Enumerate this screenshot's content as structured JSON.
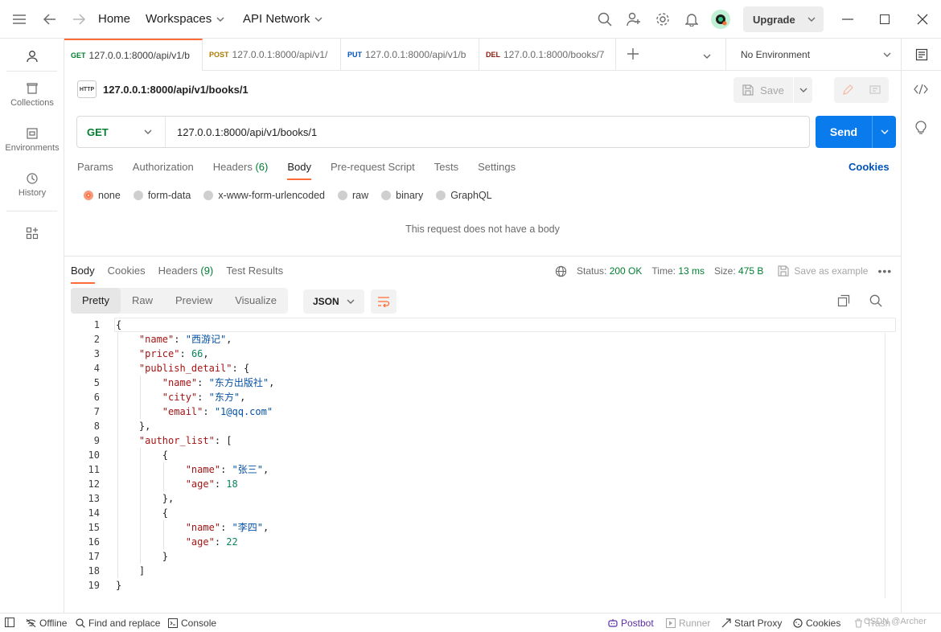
{
  "topbar": {
    "home": "Home",
    "workspaces": "Workspaces",
    "api_network": "API Network",
    "upgrade": "Upgrade"
  },
  "sidebar": {
    "items": [
      {
        "label": "Collections"
      },
      {
        "label": "Environments"
      },
      {
        "label": "History"
      }
    ]
  },
  "tabs": [
    {
      "method": "GET",
      "method_color": "#007f31",
      "url": "127.0.0.1:8000/api/v1/b"
    },
    {
      "method": "POST",
      "method_color": "#ad7a03",
      "url": "127.0.0.1:8000/api/v1/"
    },
    {
      "method": "PUT",
      "method_color": "#0053b8",
      "url": "127.0.0.1:8000/api/v1/b"
    },
    {
      "method": "DEL",
      "method_color": "#8e1a10",
      "url": "127.0.0.1:8000/books/7"
    }
  ],
  "environment": "No Environment",
  "request": {
    "title": "127.0.0.1:8000/api/v1/books/1",
    "save_label": "Save",
    "method": "GET",
    "url": "127.0.0.1:8000/api/v1/books/1",
    "send_label": "Send",
    "tabs": [
      "Params",
      "Authorization",
      "Headers",
      "Body",
      "Pre-request Script",
      "Tests",
      "Settings"
    ],
    "headers_count": "(6)",
    "cookies_label": "Cookies",
    "body_types": [
      "none",
      "form-data",
      "x-www-form-urlencoded",
      "raw",
      "binary",
      "GraphQL"
    ],
    "no_body_text": "This request does not have a body"
  },
  "response": {
    "tabs": [
      "Body",
      "Cookies",
      "Headers",
      "Test Results"
    ],
    "headers_count": "(9)",
    "status_label": "Status:",
    "status_value": "200 OK",
    "time_label": "Time:",
    "time_value": "13 ms",
    "size_label": "Size:",
    "size_value": "475 B",
    "save_example": "Save as example",
    "views": [
      "Pretty",
      "Raw",
      "Preview",
      "Visualize"
    ],
    "format": "JSON"
  },
  "statusbar": {
    "offline": "Offline",
    "find_replace": "Find and replace",
    "console": "Console",
    "postbot": "Postbot",
    "runner": "Runner",
    "start_proxy": "Start Proxy",
    "cookies": "Cookies",
    "trash": "Trash",
    "watermark": "CSDN @Archer"
  },
  "code_lines": [
    {
      "n": "1",
      "html": "{"
    },
    {
      "n": "2",
      "html": "    <span class='k'>\"name\"</span>: <span class='s'>\"西游记\"</span>,"
    },
    {
      "n": "3",
      "html": "    <span class='k'>\"price\"</span>: <span class='n'>66</span>,"
    },
    {
      "n": "4",
      "html": "    <span class='k'>\"publish_detail\"</span>: {"
    },
    {
      "n": "5",
      "html": "        <span class='k'>\"name\"</span>: <span class='s'>\"东方出版社\"</span>,"
    },
    {
      "n": "6",
      "html": "        <span class='k'>\"city\"</span>: <span class='s'>\"东方\"</span>,"
    },
    {
      "n": "7",
      "html": "        <span class='k'>\"email\"</span>: <span class='s'>\"1@qq.com\"</span>"
    },
    {
      "n": "8",
      "html": "    },"
    },
    {
      "n": "9",
      "html": "    <span class='k'>\"author_list\"</span>: ["
    },
    {
      "n": "10",
      "html": "        {"
    },
    {
      "n": "11",
      "html": "            <span class='k'>\"name\"</span>: <span class='s'>\"张三\"</span>,"
    },
    {
      "n": "12",
      "html": "            <span class='k'>\"age\"</span>: <span class='n'>18</span>"
    },
    {
      "n": "13",
      "html": "        },"
    },
    {
      "n": "14",
      "html": "        {"
    },
    {
      "n": "15",
      "html": "            <span class='k'>\"name\"</span>: <span class='s'>\"李四\"</span>,"
    },
    {
      "n": "16",
      "html": "            <span class='k'>\"age\"</span>: <span class='n'>22</span>"
    },
    {
      "n": "17",
      "html": "        }"
    },
    {
      "n": "18",
      "html": "    ]"
    },
    {
      "n": "19",
      "html": "}"
    }
  ]
}
